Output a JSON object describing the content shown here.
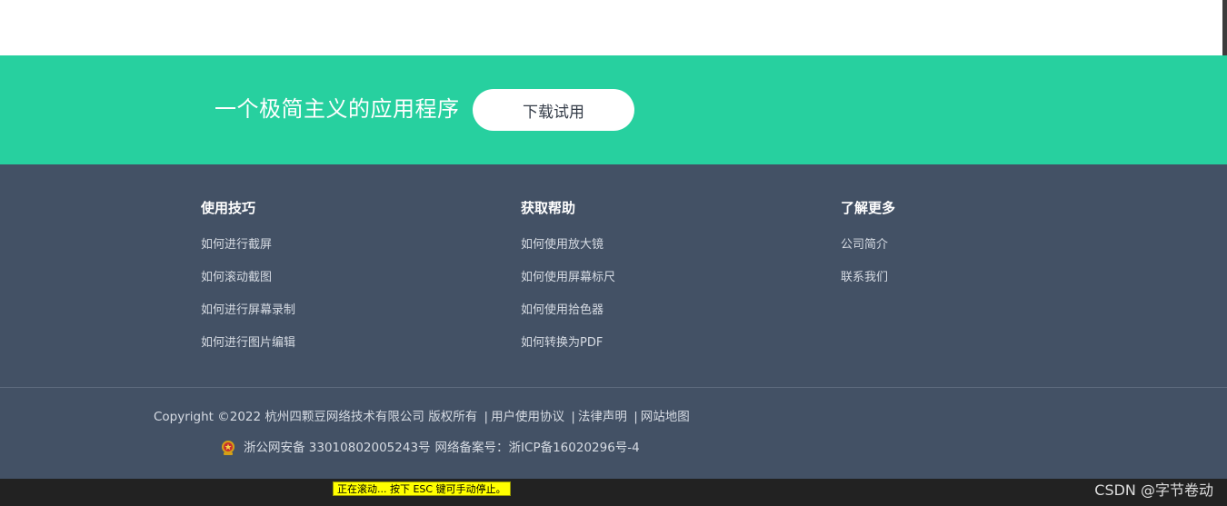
{
  "cta": {
    "tagline": "一个极简主义的应用程序",
    "button_label": "下载试用"
  },
  "footer": {
    "columns": [
      {
        "title": "使用技巧",
        "links": [
          "如何进行截屏",
          "如何滚动截图",
          "如何进行屏幕录制",
          "如何进行图片编辑"
        ]
      },
      {
        "title": "获取帮助",
        "links": [
          "如何使用放大镜",
          "如何使用屏幕标尺",
          "如何使用拾色器",
          "如何转换为PDF"
        ]
      },
      {
        "title": "了解更多",
        "links": [
          "公司简介",
          "联系我们"
        ]
      }
    ],
    "copyright": {
      "text": "Copyright ©2022 杭州四颗豆网络技术有限公司 版权所有",
      "links": [
        "用户使用协议",
        "法律声明",
        "网站地图"
      ],
      "separator": "|"
    },
    "record": {
      "police": "浙公网安备 33010802005243号",
      "icp": "网络备案号：浙ICP备16020296号-4"
    }
  },
  "overlay": {
    "scroll_notice": "正在滚动... 按下 ESC 键可手动停止。",
    "watermark": "CSDN @字节卷动"
  },
  "colors": {
    "accent": "#27d09f",
    "footer_bg": "#435165",
    "button_text": "#333b47"
  },
  "icons": {
    "police_badge": "police-badge-icon"
  }
}
